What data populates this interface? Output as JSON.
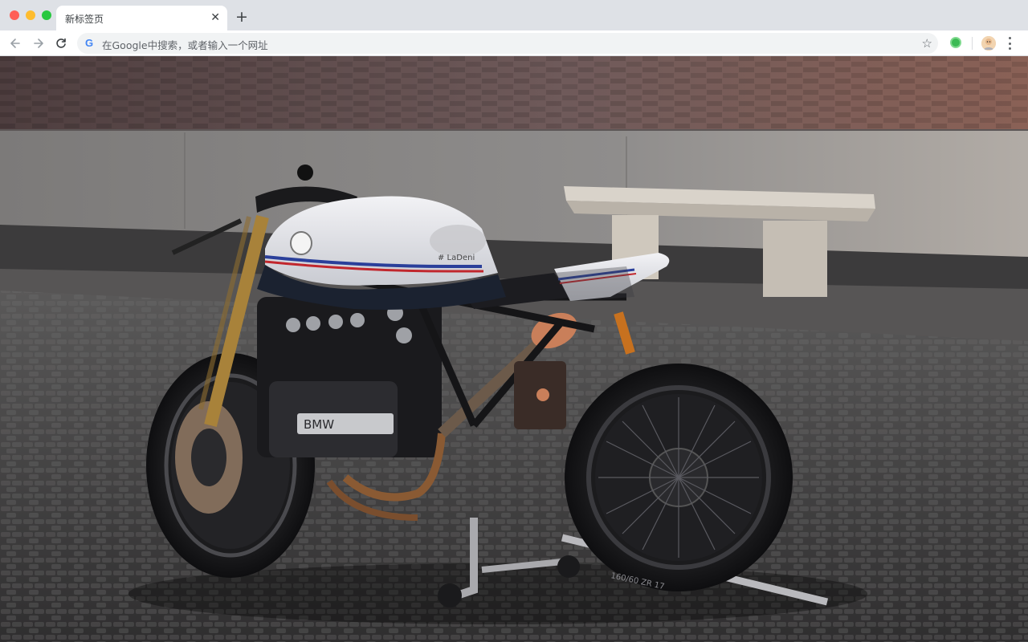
{
  "window": {
    "controls": [
      "close",
      "minimize",
      "maximize"
    ],
    "control_colors": [
      "#ff5f57",
      "#febc2e",
      "#28c840"
    ]
  },
  "tabs": [
    {
      "title": "新标签页",
      "close_icon": "close-icon",
      "active": true
    }
  ],
  "new_tab_icon": "plus-icon",
  "toolbar": {
    "back_icon": "arrow-left-icon",
    "forward_icon": "arrow-right-icon",
    "reload_icon": "reload-icon",
    "omnibox": {
      "logo": "G",
      "placeholder": "在Google中搜索，或者输入一个网址",
      "value": ""
    },
    "bookmark_icon": "star-icon",
    "extension_icon": "green-circle-icon",
    "profile_icon": "avatar-icon",
    "menu_icon": "kebab-menu-icon"
  },
  "wallpaper": {
    "subject": "motorcycle",
    "brand_badge": "BMW",
    "tank_text": "# LaDeni",
    "tire_text": "160/60 ZR 17",
    "colors": {
      "wall_brick": "#6e5552",
      "wall_stone": "#8e8a87",
      "cobblestone": "#4a4848",
      "tank": "#e6e6ea",
      "stripe_blue": "#2a3f9a",
      "stripe_red": "#c1272d",
      "frame": "#151517",
      "fork_gold": "#a8823a"
    }
  }
}
